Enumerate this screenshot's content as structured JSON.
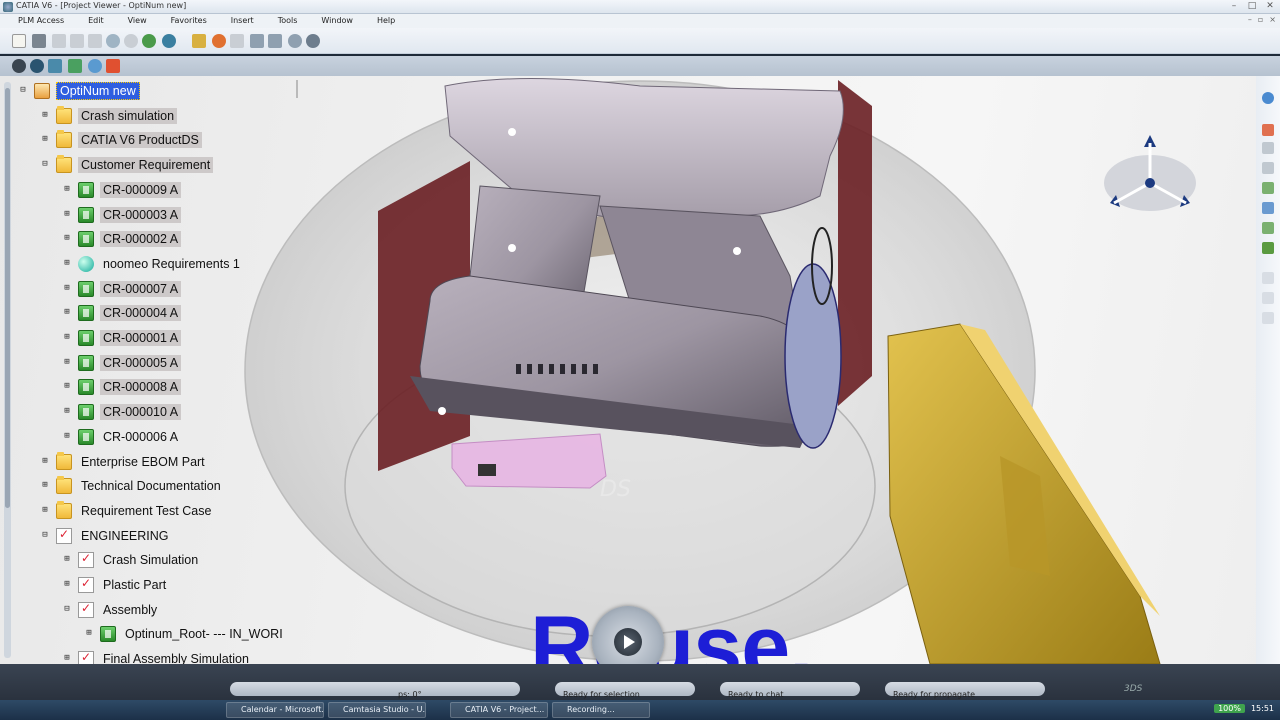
{
  "window": {
    "title": "CATIA V6 - [Project Viewer - OptiNum new]"
  },
  "menu": [
    "PLM Access",
    "Edit",
    "View",
    "Favorites",
    "Insert",
    "Tools",
    "Window",
    "Help"
  ],
  "tree": {
    "items": [
      {
        "label": "OptiNum new",
        "level": 0,
        "expander": "⊟",
        "icon": "root",
        "style": "sel"
      },
      {
        "label": "Crash simulation",
        "level": 1,
        "expander": "⊞",
        "icon": "folder",
        "style": "hl"
      },
      {
        "label": "CATIA V6 ProductDS",
        "level": 1,
        "expander": "⊞",
        "icon": "folder",
        "style": "hl"
      },
      {
        "label": "Customer Requirement",
        "level": 1,
        "expander": "⊟",
        "icon": "folder",
        "style": "hl"
      },
      {
        "label": "CR-000009 A",
        "level": 2,
        "expander": "⊞",
        "icon": "req",
        "style": "hl"
      },
      {
        "label": "CR-000003 A",
        "level": 2,
        "expander": "⊞",
        "icon": "req",
        "style": "hl"
      },
      {
        "label": "CR-000002 A",
        "level": 2,
        "expander": "⊞",
        "icon": "req",
        "style": "hl"
      },
      {
        "label": "noomeo Requirements 1",
        "level": 2,
        "expander": "⊞",
        "icon": "globe",
        "style": ""
      },
      {
        "label": "CR-000007 A",
        "level": 2,
        "expander": "⊞",
        "icon": "req",
        "style": "hl"
      },
      {
        "label": "CR-000004 A",
        "level": 2,
        "expander": "⊞",
        "icon": "req",
        "style": "hl"
      },
      {
        "label": "CR-000001 A",
        "level": 2,
        "expander": "⊞",
        "icon": "req",
        "style": "hl"
      },
      {
        "label": "CR-000005 A",
        "level": 2,
        "expander": "⊞",
        "icon": "req",
        "style": "hl"
      },
      {
        "label": "CR-000008 A",
        "level": 2,
        "expander": "⊞",
        "icon": "req",
        "style": "hl"
      },
      {
        "label": "CR-000010 A",
        "level": 2,
        "expander": "⊞",
        "icon": "req",
        "style": "hl"
      },
      {
        "label": "CR-000006 A",
        "level": 2,
        "expander": "⊞",
        "icon": "req",
        "style": ""
      },
      {
        "label": "Enterprise EBOM Part",
        "level": 1,
        "expander": "⊞",
        "icon": "folder",
        "style": ""
      },
      {
        "label": "Technical Documentation",
        "level": 1,
        "expander": "⊞",
        "icon": "folder",
        "style": ""
      },
      {
        "label": "Requirement Test Case",
        "level": 1,
        "expander": "⊞",
        "icon": "folder",
        "style": ""
      },
      {
        "label": "ENGINEERING",
        "level": 1,
        "expander": "⊟",
        "icon": "checkbox",
        "style": ""
      },
      {
        "label": "Crash Simulation",
        "level": 2,
        "expander": "⊞",
        "icon": "checkbox",
        "style": ""
      },
      {
        "label": "Plastic Part",
        "level": 2,
        "expander": "⊞",
        "icon": "checkbox",
        "style": ""
      },
      {
        "label": "Assembly",
        "level": 2,
        "expander": "⊟",
        "icon": "checkbox",
        "style": ""
      },
      {
        "label": "Optinum_Root- --- IN_WORI",
        "level": 3,
        "expander": "⊞",
        "icon": "product",
        "style": ""
      },
      {
        "label": "Final Assembly Simulation",
        "level": 2,
        "expander": "⊞",
        "icon": "checkbox",
        "style": ""
      }
    ]
  },
  "caption": "Reuse.",
  "status": {
    "prompt": "ps: 0°",
    "selection": "Ready for selection",
    "chat": "Ready to chat",
    "propagate": "Ready for propagate"
  },
  "taskbar": {
    "items": [
      "Calendar - Microsoft...",
      "Camtasia Studio - U...",
      "CATIA V6 - Project...",
      "Recording..."
    ],
    "zoom": "100%",
    "clock": "15:51"
  },
  "colors": {
    "caption": "#1d1ed6",
    "selection": "#2f5ee0"
  }
}
